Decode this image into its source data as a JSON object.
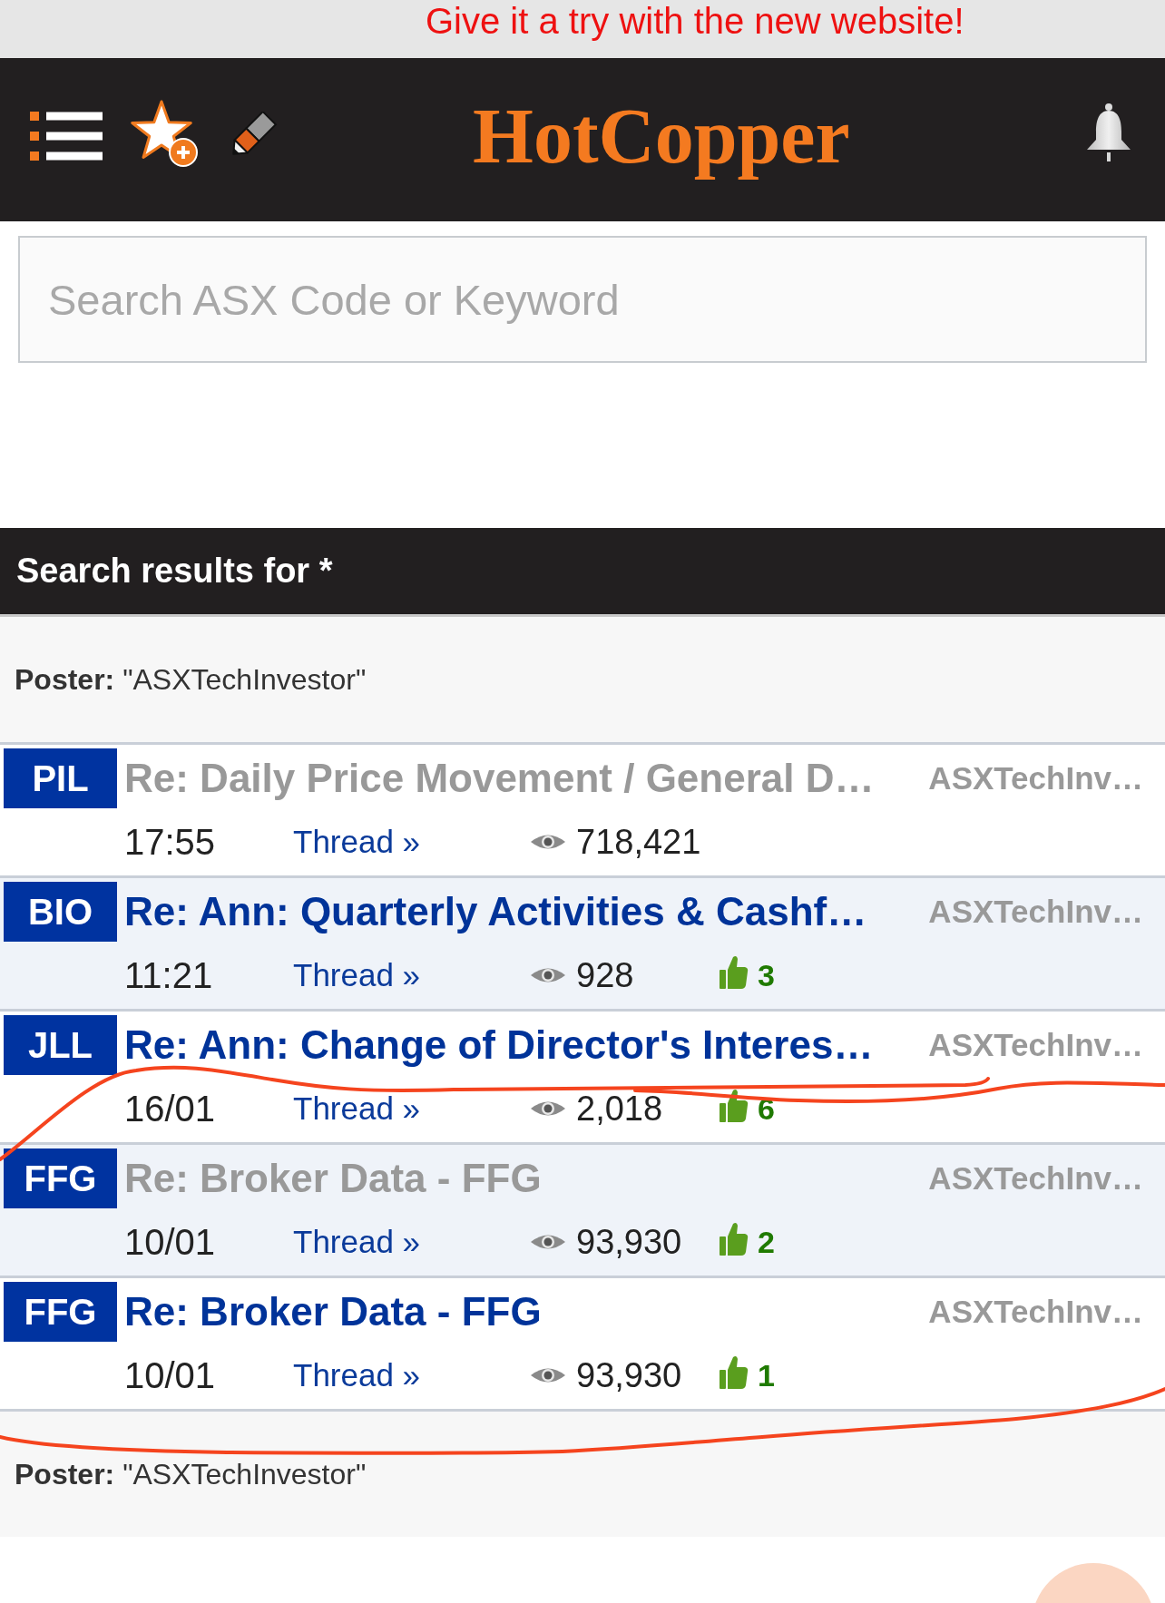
{
  "banner": {
    "text": "Give it a try with the new website!"
  },
  "header": {
    "logo": "HotCopper"
  },
  "search": {
    "placeholder": "Search ASX Code or Keyword"
  },
  "results": {
    "heading": "Search results for *",
    "poster": "**Poster:** \"ASXTechInvestor\"",
    "rows": [
      {
        "code": "PIL",
        "title": "Re: Daily Price Movement / General D…",
        "visited": true,
        "author": "ASXTechInv…",
        "time": "17:55",
        "link": "Thread »",
        "views": "718,421"
      },
      {
        "code": "BIO",
        "title": "Re: Ann: Quarterly Activities & Cashf…",
        "visited": false,
        "author": "ASXTechInv…",
        "time": "11:21",
        "link": "Thread »",
        "views": "928",
        "likes": "3"
      },
      {
        "code": "JLL",
        "title": "Re: Ann: Change of Director's Interes…",
        "visited": false,
        "author": "ASXTechInv…",
        "time": "16/01",
        "link": "Thread »",
        "views": "2,018",
        "likes": "6"
      },
      {
        "code": "FFG",
        "title": "Re: Broker Data - FFG",
        "visited": true,
        "author": "ASXTechInv…",
        "time": "10/01",
        "link": "Thread »",
        "views": "93,930",
        "likes": "2"
      },
      {
        "code": "FFG",
        "title": "Re: Broker Data - FFG",
        "visited": false,
        "author": "ASXTechInv…",
        "time": "10/01",
        "link": "Thread »",
        "views": "93,930",
        "likes": "1"
      }
    ],
    "poster_footer": "**Poster:** \"ASXTechInvestor\""
  }
}
